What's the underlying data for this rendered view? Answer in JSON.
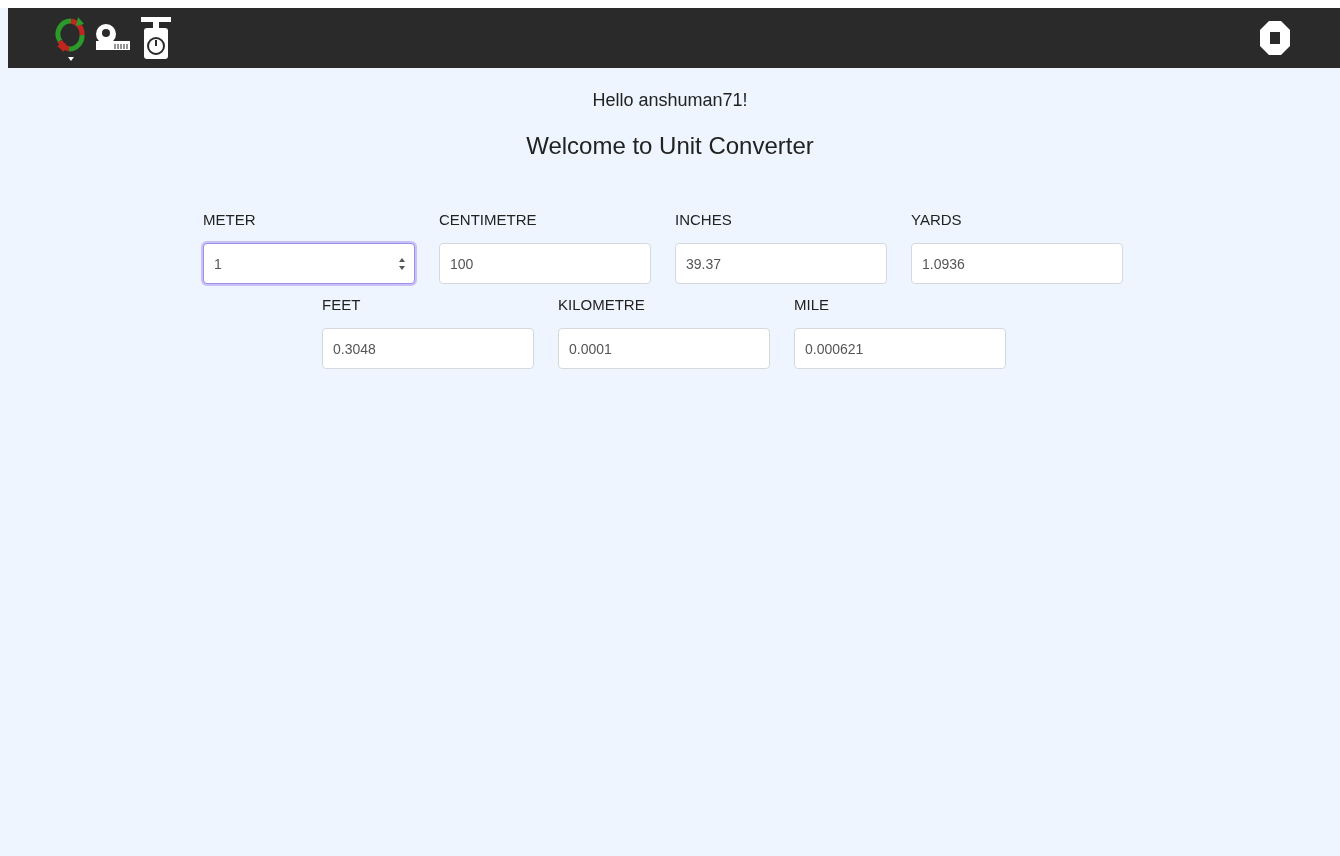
{
  "greeting": "Hello anshuman71!",
  "title": "Welcome to Unit Converter",
  "rows": [
    [
      {
        "label": "METER",
        "value": "1",
        "kind": "number",
        "focused": true
      },
      {
        "label": "CENTIMETRE",
        "value": "100",
        "kind": "text",
        "focused": false
      },
      {
        "label": "INCHES",
        "value": "39.37",
        "kind": "text",
        "focused": false
      },
      {
        "label": "YARDS",
        "value": "1.0936",
        "kind": "text",
        "focused": false
      }
    ],
    [
      {
        "label": "FEET",
        "value": "0.3048",
        "kind": "text",
        "focused": false
      },
      {
        "label": "KILOMETRE",
        "value": "0.0001",
        "kind": "text",
        "focused": false
      },
      {
        "label": "MILE",
        "value": "0.000621",
        "kind": "text",
        "focused": false
      }
    ]
  ]
}
